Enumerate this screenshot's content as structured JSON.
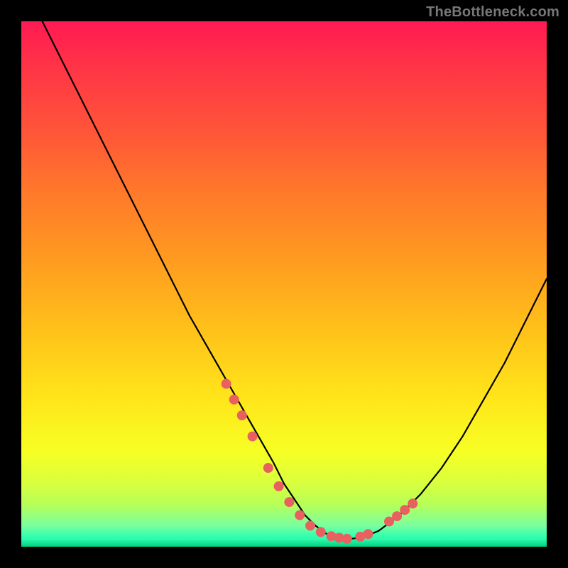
{
  "watermark": "TheBottleneck.com",
  "chart_data": {
    "type": "line",
    "title": "",
    "xlabel": "",
    "ylabel": "",
    "xlim": [
      0,
      100
    ],
    "ylim": [
      0,
      100
    ],
    "grid": false,
    "legend": false,
    "note": "Axis values are unlabeled in the source image; curve points are estimated on a 0–100 normalized range.",
    "series": [
      {
        "name": "bottleneck-curve",
        "color": "#000000",
        "x": [
          4,
          8,
          12,
          16,
          20,
          24,
          28,
          32,
          36,
          40,
          44,
          48,
          50,
          52,
          54,
          56,
          58,
          60,
          62,
          65,
          68,
          72,
          76,
          80,
          84,
          88,
          92,
          96,
          100
        ],
        "y": [
          100,
          92,
          84,
          76,
          68,
          60,
          52,
          44,
          37,
          30,
          23,
          16,
          12,
          9,
          6,
          4,
          2.5,
          1.8,
          1.4,
          1.8,
          3,
          6,
          10,
          15,
          21,
          28,
          35,
          43,
          51
        ]
      },
      {
        "name": "highlight-dots",
        "color": "#e96060",
        "display": "markers",
        "x": [
          39,
          40.5,
          42,
          44,
          47,
          49,
          51,
          53,
          55,
          57,
          59,
          60.5,
          62,
          64.5,
          66,
          70,
          71.5,
          73,
          74.5
        ],
        "y": [
          31,
          28,
          25,
          21,
          15,
          11.5,
          8.5,
          6,
          4,
          2.8,
          2,
          1.7,
          1.5,
          1.9,
          2.4,
          4.8,
          5.8,
          7,
          8.2
        ]
      }
    ]
  }
}
